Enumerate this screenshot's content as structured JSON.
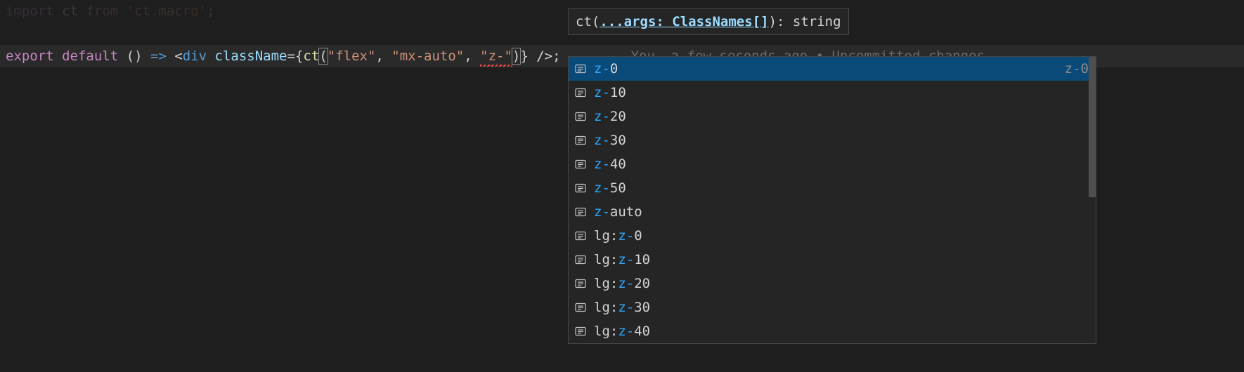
{
  "code": {
    "line1": {
      "full": "import ct from 'ct.macro';",
      "kw1": "import",
      "name": "ct",
      "kw2": "from",
      "str": "'ct.macro'",
      "semi": ";"
    },
    "line2": {
      "kw_export": "export",
      "kw_default": "default",
      "parens": "()",
      "arrow": "=>",
      "open_tag": "<",
      "tag": "div",
      "attr": "className",
      "eq": "=",
      "brace_open": "{",
      "func": "ct",
      "paren_open": "(",
      "str1": "\"flex\"",
      "comma1": ", ",
      "str2": "\"mx-auto\"",
      "comma2": ", ",
      "str3": "\"z-\"",
      "paren_close": ")",
      "brace_close": "}",
      "slash_close": " />",
      "semi": ";"
    }
  },
  "git_lens": "You, a few seconds ago • Uncommitted changes",
  "signature": {
    "func": "ct",
    "open": "(",
    "param": "...args: ClassNames[]",
    "close": ")",
    "colon": ": ",
    "ret": "string"
  },
  "suggestions": [
    {
      "pre": "",
      "match": "z-",
      "post": "0",
      "selected": true,
      "detail": "z-0"
    },
    {
      "pre": "",
      "match": "z-",
      "post": "10",
      "selected": false,
      "detail": ""
    },
    {
      "pre": "",
      "match": "z-",
      "post": "20",
      "selected": false,
      "detail": ""
    },
    {
      "pre": "",
      "match": "z-",
      "post": "30",
      "selected": false,
      "detail": ""
    },
    {
      "pre": "",
      "match": "z-",
      "post": "40",
      "selected": false,
      "detail": ""
    },
    {
      "pre": "",
      "match": "z-",
      "post": "50",
      "selected": false,
      "detail": ""
    },
    {
      "pre": "",
      "match": "z-",
      "post": "auto",
      "selected": false,
      "detail": ""
    },
    {
      "pre": "lg:",
      "match": "z-",
      "post": "0",
      "selected": false,
      "detail": ""
    },
    {
      "pre": "lg:",
      "match": "z-",
      "post": "10",
      "selected": false,
      "detail": ""
    },
    {
      "pre": "lg:",
      "match": "z-",
      "post": "20",
      "selected": false,
      "detail": ""
    },
    {
      "pre": "lg:",
      "match": "z-",
      "post": "30",
      "selected": false,
      "detail": ""
    },
    {
      "pre": "lg:",
      "match": "z-",
      "post": "40",
      "selected": false,
      "detail": ""
    }
  ]
}
